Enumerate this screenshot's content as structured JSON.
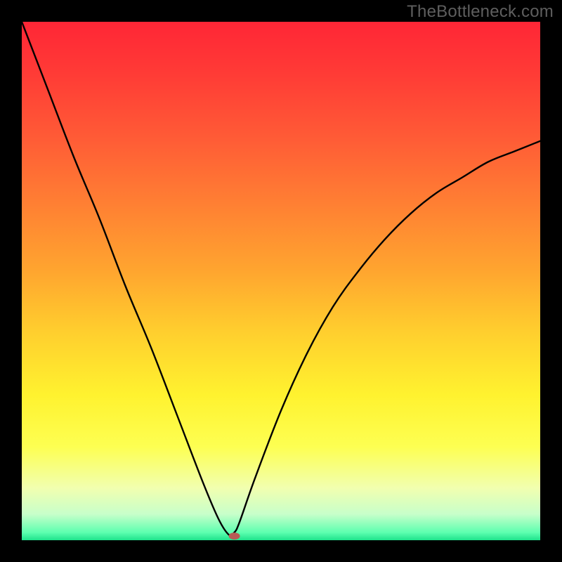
{
  "watermark": "TheBottleneck.com",
  "chart_data": {
    "type": "line",
    "title": "",
    "xlabel": "",
    "ylabel": "",
    "xlim": [
      0,
      100
    ],
    "ylim": [
      0,
      100
    ],
    "series": [
      {
        "name": "curve",
        "x": [
          0,
          5,
          10,
          15,
          20,
          25,
          30,
          35,
          38,
          40,
          41,
          42,
          45,
          50,
          55,
          60,
          65,
          70,
          75,
          80,
          85,
          90,
          95,
          100
        ],
        "y": [
          100,
          87,
          74,
          62,
          49,
          37,
          24,
          11,
          4,
          1,
          1.5,
          3.5,
          12,
          25,
          36,
          45,
          52,
          58,
          63,
          67,
          70,
          73,
          75,
          77
        ]
      }
    ],
    "marker": {
      "x": 41,
      "y": 0.8,
      "color": "#b85a55",
      "rx": 8,
      "ry": 5
    },
    "background_gradient": {
      "stops": [
        {
          "offset": 0.0,
          "color": "#ff2636"
        },
        {
          "offset": 0.1,
          "color": "#ff3b36"
        },
        {
          "offset": 0.22,
          "color": "#ff5a36"
        },
        {
          "offset": 0.35,
          "color": "#ff7f33"
        },
        {
          "offset": 0.48,
          "color": "#ffa52f"
        },
        {
          "offset": 0.6,
          "color": "#ffcf2e"
        },
        {
          "offset": 0.72,
          "color": "#fff22f"
        },
        {
          "offset": 0.82,
          "color": "#fdff52"
        },
        {
          "offset": 0.9,
          "color": "#f1ffb0"
        },
        {
          "offset": 0.95,
          "color": "#c7ffca"
        },
        {
          "offset": 0.985,
          "color": "#5dffb0"
        },
        {
          "offset": 1.0,
          "color": "#1ee28b"
        }
      ]
    },
    "line_style": {
      "color": "#000000",
      "width": 2.4
    }
  }
}
